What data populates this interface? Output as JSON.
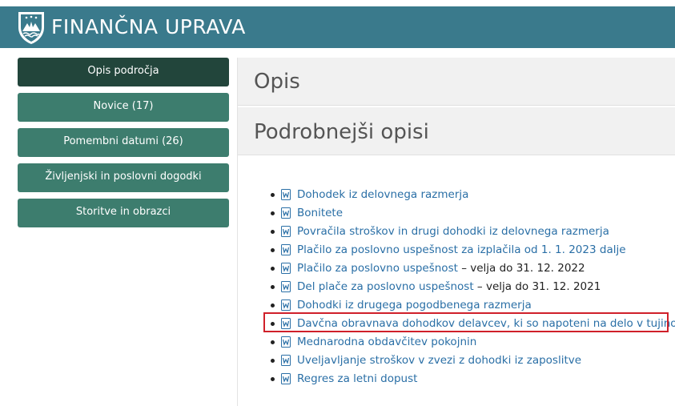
{
  "header": {
    "title": "FINANČNA UPRAVA",
    "logo_icon": "slovenia-coat-of-arms-icon",
    "bg_color": "#3a7a8c"
  },
  "sidebar": {
    "items": [
      {
        "label": "Opis področja",
        "active": true
      },
      {
        "label": "Novice (17)",
        "active": false
      },
      {
        "label": "Pomembni datumi (26)",
        "active": false
      },
      {
        "label": "Življenjski in poslovni dogodki",
        "active": false
      },
      {
        "label": "Storitve in obrazci",
        "active": false
      }
    ]
  },
  "main": {
    "section_opis": "Opis",
    "section_podrobnejsi": "Podrobnejši opisi",
    "documents": [
      {
        "link": "Dohodek iz delovnega razmerja",
        "note": ""
      },
      {
        "link": "Bonitete",
        "note": ""
      },
      {
        "link": "Povračila stroškov in drugi dohodki iz delovnega razmerja",
        "note": ""
      },
      {
        "link": "Plačilo za poslovno uspešnost za izplačila od 1. 1. 2023 dalje",
        "note": ""
      },
      {
        "link": "Plačilo za poslovno uspešnost",
        "note": " – velja do 31. 12. 2022"
      },
      {
        "link": "Del plače za poslovno uspešnost",
        "note": " – velja do 31. 12. 2021"
      },
      {
        "link": "Dohodki iz drugega pogodbenega razmerja",
        "note": ""
      },
      {
        "link": "Davčna obravnava dohodkov delavcev, ki so napoteni na delo v tujino",
        "note": "",
        "highlighted": true
      },
      {
        "link": "Mednarodna obdavčitev pokojnin",
        "note": ""
      },
      {
        "link": "Uveljavljanje stroškov v zvezi z dohodki iz zaposlitve",
        "note": ""
      },
      {
        "link": "Regres za letni dopust",
        "note": ""
      }
    ],
    "doc_icon": "word-document-icon",
    "highlight_color": "#d0202a"
  }
}
